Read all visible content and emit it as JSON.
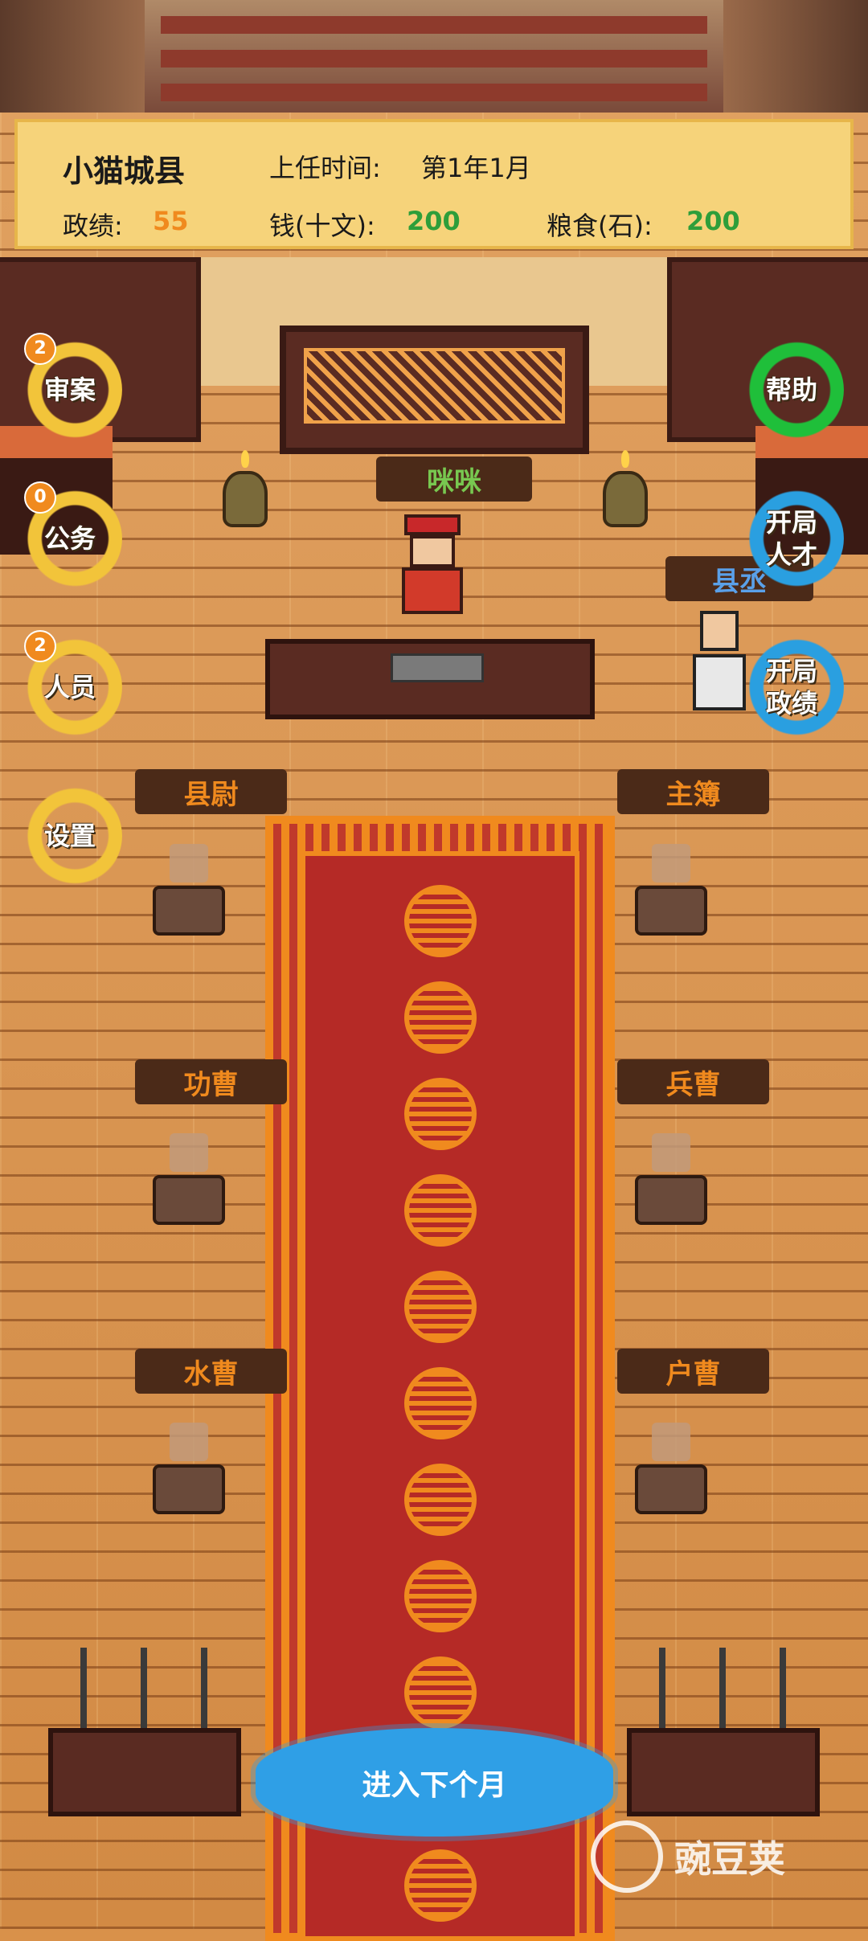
{
  "status_panel": {
    "county_name": "小猫城县",
    "term_label": "上任时间:",
    "term_value": "第1年1月",
    "merit_label": "政绩:",
    "merit_value": "55",
    "money_label": "钱(十文):",
    "money_value": "200",
    "grain_label": "粮食(石):",
    "grain_value": "200"
  },
  "left_buttons": [
    {
      "label": "审案",
      "badge": "2"
    },
    {
      "label": "公务",
      "badge": "0"
    },
    {
      "label": "人员",
      "badge": "2"
    },
    {
      "label": "设置"
    }
  ],
  "right_buttons": [
    {
      "label": "帮助"
    },
    {
      "label_line1": "开局",
      "label_line2": "人才"
    },
    {
      "label_line1": "开局",
      "label_line2": "政绩"
    }
  ],
  "characters": {
    "magistrate_name": "咪咪",
    "deputy_title": "县丞"
  },
  "officer_plates": {
    "left": [
      "县尉",
      "功曹",
      "水曹"
    ],
    "right": [
      "主簿",
      "兵曹",
      "户曹"
    ]
  },
  "next_month_button": "进入下个月",
  "watermark_text": "豌豆荚",
  "icons": {
    "case": "scale-icon",
    "office": "scroll-icon",
    "staff": "people-icon",
    "settings": "gear-icon",
    "help": "question-icon"
  },
  "colors": {
    "panel_bg": "#f6d37a",
    "merit_value": "#f08a1e",
    "money_value": "#2e9e3a",
    "grain_value": "#2e9e3a",
    "ring_yellow": "#f2c43a",
    "ring_green": "#1fbf3a",
    "ring_blue": "#2a9fe0",
    "carpet": "#b52a26"
  }
}
